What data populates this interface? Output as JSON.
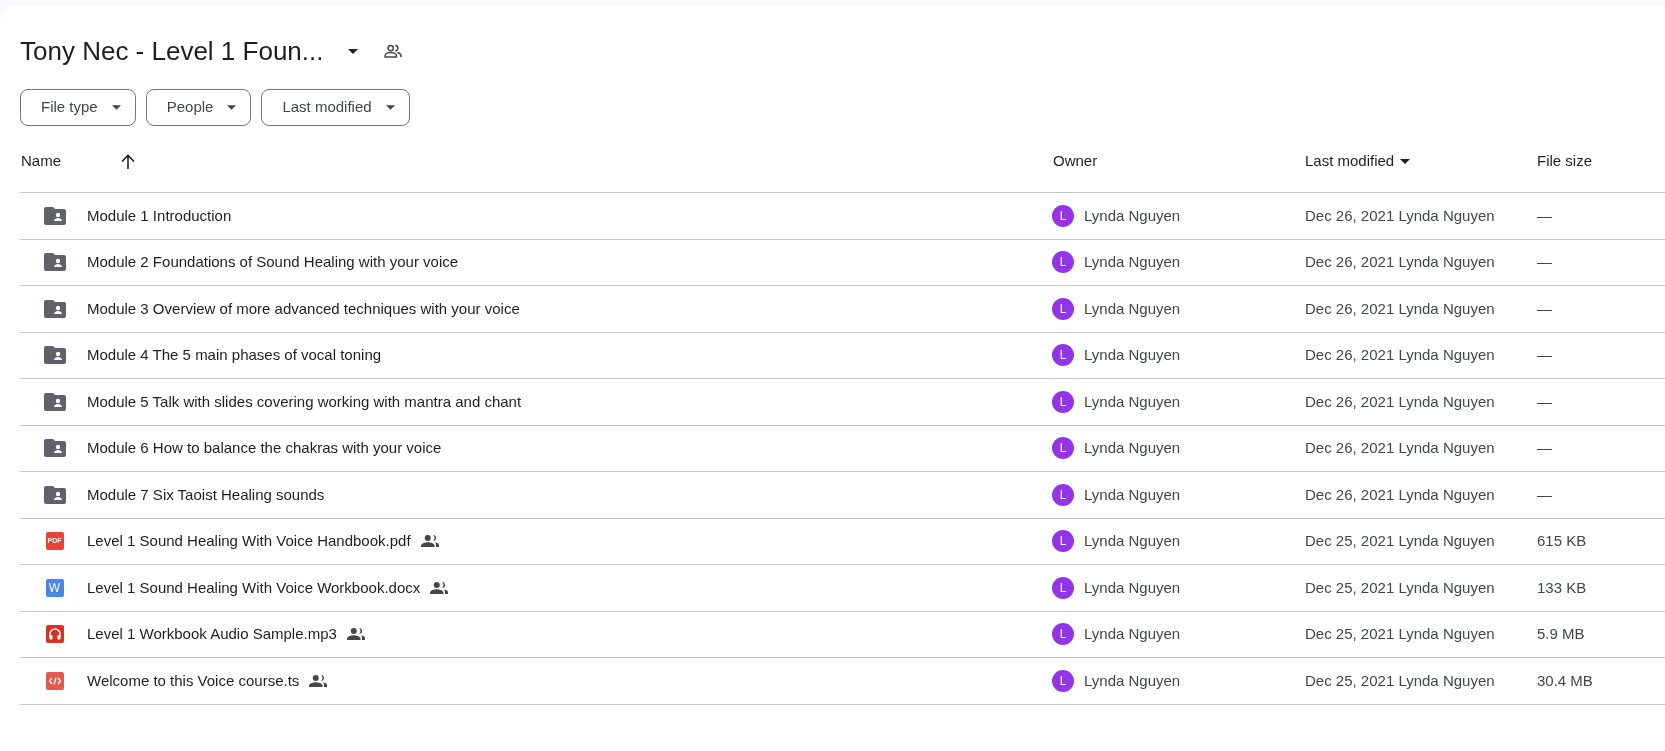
{
  "title": "Tony Nec - Level 1 Foun...",
  "filters": [
    "File type",
    "People",
    "Last modified"
  ],
  "columns": [
    {
      "label": "Name",
      "kind": "sortup"
    },
    {
      "label": "Owner",
      "kind": "plain"
    },
    {
      "label": "Last modified",
      "kind": "sortdown"
    },
    {
      "label": "File size",
      "kind": "plain"
    }
  ],
  "rows": [
    {
      "kind": "folder",
      "name": "Module 1 Introduction",
      "shared": false,
      "owner_initial": "L",
      "owner": "Lynda Nguyen",
      "modified": "Dec 26, 2021 Lynda Nguyen",
      "size": "—"
    },
    {
      "kind": "folder",
      "name": "Module 2 Foundations of Sound Healing with your voice",
      "shared": false,
      "owner_initial": "L",
      "owner": "Lynda Nguyen",
      "modified": "Dec 26, 2021 Lynda Nguyen",
      "size": "—"
    },
    {
      "kind": "folder",
      "name": "Module 3 Overview of more advanced techniques with your voice",
      "shared": false,
      "owner_initial": "L",
      "owner": "Lynda Nguyen",
      "modified": "Dec 26, 2021 Lynda Nguyen",
      "size": "—"
    },
    {
      "kind": "folder",
      "name": "Module 4 The 5 main phases of vocal toning",
      "shared": false,
      "owner_initial": "L",
      "owner": "Lynda Nguyen",
      "modified": "Dec 26, 2021 Lynda Nguyen",
      "size": "—"
    },
    {
      "kind": "folder",
      "name": "Module 5 Talk with slides covering working with mantra and chant",
      "shared": false,
      "owner_initial": "L",
      "owner": "Lynda Nguyen",
      "modified": "Dec 26, 2021 Lynda Nguyen",
      "size": "—"
    },
    {
      "kind": "folder",
      "name": "Module 6 How to balance the chakras with your voice",
      "shared": false,
      "owner_initial": "L",
      "owner": "Lynda Nguyen",
      "modified": "Dec 26, 2021 Lynda Nguyen",
      "size": "—"
    },
    {
      "kind": "folder",
      "name": "Module 7 Six Taoist Healing sounds",
      "shared": false,
      "owner_initial": "L",
      "owner": "Lynda Nguyen",
      "modified": "Dec 26, 2021 Lynda Nguyen",
      "size": "—"
    },
    {
      "kind": "pdf",
      "icon_text": "PDF",
      "name": "Level 1 Sound Healing With Voice Handbook.pdf",
      "shared": true,
      "owner_initial": "L",
      "owner": "Lynda Nguyen",
      "modified": "Dec 25, 2021 Lynda Nguyen",
      "size": "615 KB"
    },
    {
      "kind": "word",
      "icon_text": "W",
      "name": "Level 1 Sound Healing With Voice Workbook.docx",
      "shared": true,
      "owner_initial": "L",
      "owner": "Lynda Nguyen",
      "modified": "Dec 25, 2021 Lynda Nguyen",
      "size": "133 KB"
    },
    {
      "kind": "audio",
      "name": "Level 1 Workbook Audio Sample.mp3",
      "shared": true,
      "owner_initial": "L",
      "owner": "Lynda Nguyen",
      "modified": "Dec 25, 2021 Lynda Nguyen",
      "size": "5.9 MB"
    },
    {
      "kind": "code",
      "name": "Welcome to this Voice course.ts",
      "shared": true,
      "owner_initial": "L",
      "owner": "Lynda Nguyen",
      "modified": "Dec 25, 2021 Lynda Nguyen",
      "size": "30.4 MB"
    }
  ]
}
